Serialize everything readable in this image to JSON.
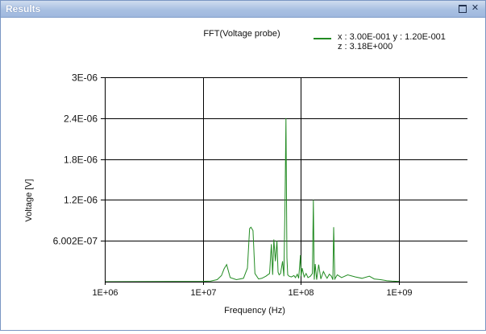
{
  "window": {
    "title": "Results"
  },
  "title_buttons": {
    "maximize_icon": "maximize-icon",
    "close_icon": "close-icon",
    "close_glyph": "✕"
  },
  "chart_data": {
    "type": "line",
    "title": "FFT(Voltage probe)",
    "xlabel": "Frequency (Hz)",
    "ylabel": "Voltage [V]",
    "x_scale": "log",
    "xlim": [
      1000000,
      5000000000
    ],
    "ylim": [
      0,
      3e-06
    ],
    "x_ticks": [
      1000000,
      10000000,
      100000000,
      1000000000
    ],
    "x_tick_labels": [
      "1E+06",
      "1E+07",
      "1E+08",
      "1E+09"
    ],
    "y_ticks": [
      3e-06,
      2.4e-06,
      1.8e-06,
      1.2e-06,
      6.002e-07
    ],
    "y_tick_labels": [
      "3E-06",
      "2.4E-06",
      "1.8E-06",
      "1.2E-06",
      "6.002E-07"
    ],
    "grid": true,
    "legend_position": "top-right",
    "legend": {
      "line1": "x : 3.00E-001   y : 1.20E-001",
      "line2": "z : 3.18E+000",
      "color": "#228b22"
    },
    "series": [
      {
        "color": "#228b22",
        "x": [
          1000000,
          5000000,
          10000000,
          12000000,
          14000000,
          15500000,
          16500000,
          17500000,
          19000000,
          22000000,
          26000000,
          28500000,
          30000000,
          31000000,
          32500000,
          34000000,
          37000000,
          40000000,
          44000000,
          48000000,
          50000000,
          51500000,
          53000000,
          55000000,
          57000000,
          58500000,
          60000000,
          62000000,
          65000000,
          67000000,
          69000000,
          70500000,
          72000000,
          73500000,
          76000000,
          80000000,
          85000000,
          88000000,
          92000000,
          95000000,
          99000000,
          100500000,
          103000000,
          108000000,
          113000000,
          118000000,
          125000000,
          131000000,
          134000000,
          137000000,
          140000000,
          145000000,
          152000000,
          160000000,
          170000000,
          178000000,
          185000000,
          195000000,
          205000000,
          212000000,
          216000000,
          222000000,
          235000000,
          260000000,
          300000000,
          360000000,
          420000000,
          500000000,
          560000000,
          650000000,
          750000000,
          850000000,
          1000000000
        ],
        "y": [
          5e-10,
          3e-09,
          5e-09,
          1e-08,
          3e-08,
          9e-08,
          1.9e-07,
          2.5e-07,
          6e-08,
          3e-08,
          5e-08,
          2e-07,
          7.8e-07,
          8e-07,
          7.5e-07,
          1.2e-07,
          4e-08,
          5e-08,
          8e-08,
          1.2e-07,
          5.5e-07,
          1e-07,
          6.2e-07,
          3e-07,
          6e-07,
          1.4e-07,
          1e-07,
          1.2e-07,
          3e-07,
          8e-08,
          1.2e-06,
          2.4e-06,
          3.5e-07,
          1e-07,
          8e-08,
          7e-08,
          9e-08,
          6e-08,
          1.1e-07,
          5e-08,
          3.9e-07,
          8e-08,
          2e-07,
          7e-08,
          1.2e-07,
          6e-08,
          8e-08,
          1.2e-07,
          1.2e-06,
          3e-08,
          2.6e-07,
          3e-08,
          2.5e-07,
          4e-08,
          1.5e-07,
          9e-08,
          5e-08,
          1.1e-07,
          8e-08,
          3e-08,
          8e-07,
          4e-08,
          1e-07,
          6e-08,
          1e-07,
          7e-08,
          5e-08,
          8e-08,
          4e-08,
          3e-08,
          1.5e-08,
          8e-09,
          3e-09
        ]
      }
    ]
  }
}
